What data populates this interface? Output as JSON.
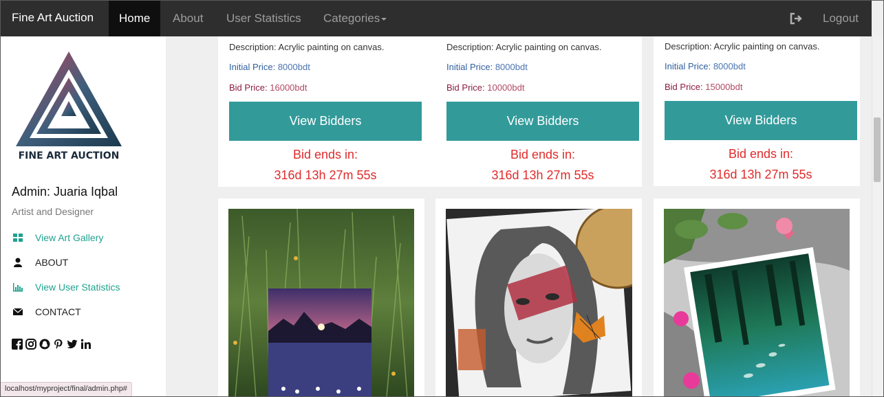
{
  "navbar": {
    "brand": "Fine Art Auction",
    "items": [
      "Home",
      "About",
      "User Statistics",
      "Categories"
    ],
    "logout": "Logout",
    "logout_icon": "sign-out-icon"
  },
  "sidebar": {
    "logo_text": "FINE ART AUCTION",
    "admin_name": "Admin: Juaria Iqbal",
    "role": "Artist and Designer",
    "menu": [
      {
        "label": "View Art Gallery",
        "icon": "grid-icon"
      },
      {
        "label": "ABOUT",
        "icon": "user-icon"
      },
      {
        "label": "View User Statistics",
        "icon": "bar-chart-icon"
      },
      {
        "label": "CONTACT",
        "icon": "envelope-icon"
      }
    ],
    "social_icons": [
      "facebook-icon",
      "instagram-icon",
      "snapchat-icon",
      "pinterest-icon",
      "twitter-icon",
      "linkedin-icon"
    ]
  },
  "status_bar": {
    "url": "localhost/myproject/final/admin.php#"
  },
  "cards": [
    {
      "description": "Description: Acrylic painting on canvas.",
      "initial_label": "Initial Price:",
      "initial_value": "8000bdt",
      "bid_label": "Bid Price:",
      "bid_value": "16000bdt",
      "button": "View Bidders",
      "ends_label": "Bid ends in:",
      "countdown": "316d 13h 27m 55s"
    },
    {
      "description": "Description: Acrylic painting on canvas.",
      "initial_label": "Initial Price:",
      "initial_value": "8000bdt",
      "bid_label": "Bid Price:",
      "bid_value": "10000bdt",
      "button": "View Bidders",
      "ends_label": "Bid ends in:",
      "countdown": "316d 13h 27m 55s"
    },
    {
      "description": "Description: Acrylic painting on canvas.",
      "initial_label": "Initial Price:",
      "initial_value": "8000bdt",
      "bid_label": "Bid Price:",
      "bid_value": "15000bdt",
      "button": "View Bidders",
      "ends_label": "Bid ends in:",
      "countdown": "316d 13h 27m 55s"
    }
  ],
  "colors": {
    "navbar_bg": "#2e2e2e",
    "accent_teal": "#339a9a",
    "countdown_red": "#e02b2b"
  }
}
